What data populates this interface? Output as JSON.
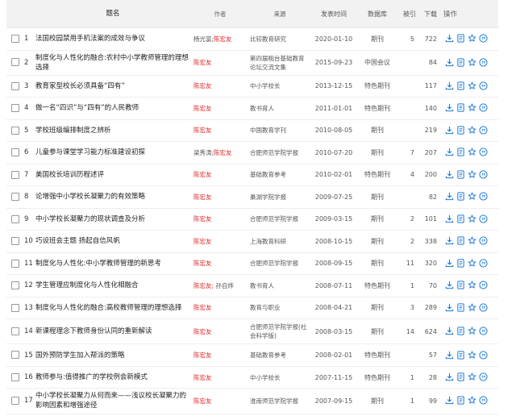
{
  "columns": {
    "title": "题名",
    "author": "作者",
    "source": "来源",
    "date": "发表时间",
    "db": "数据库",
    "cited": "被引",
    "downloads": "下载",
    "ops": "操作"
  },
  "rows": [
    {
      "num": "1",
      "title": "法国校园禁用手机法案的成效与争议",
      "authors": [
        {
          "name": "杨光富;",
          "style": "gray"
        },
        {
          "name": "陈宏友",
          "style": "red"
        }
      ],
      "source": "比较教育研究",
      "date": "2020-01-10",
      "db": "期刊",
      "cited": "5",
      "downloads": "722"
    },
    {
      "num": "2",
      "title": "制度化与人性化的融合:农村中小学教师管理的理想选择",
      "authors": [
        {
          "name": "陈宏友",
          "style": "red"
        }
      ],
      "source": "第四届桃台基础教育论坛交流文集",
      "date": "2015-09-23",
      "db": "中国会议",
      "cited": "",
      "downloads": "84"
    },
    {
      "num": "3",
      "title": "教育家型校长必须具备“四有”",
      "authors": [
        {
          "name": "陈宏友",
          "style": "red"
        }
      ],
      "source": "中小学校长",
      "date": "2013-12-15",
      "db": "特色期刊",
      "cited": "",
      "downloads": "117"
    },
    {
      "num": "4",
      "title": "做一名“四识”与“四有”的人民教师",
      "authors": [
        {
          "name": "陈宏友",
          "style": "red"
        }
      ],
      "source": "教书育人",
      "date": "2011-01-01",
      "db": "特色期刊",
      "cited": "",
      "downloads": "140"
    },
    {
      "num": "5",
      "title": "学校班级编排制度之辨析",
      "authors": [
        {
          "name": "陈宏友",
          "style": "red"
        }
      ],
      "source": "中国教育学刊",
      "date": "2010-08-05",
      "db": "期刊",
      "cited": "",
      "downloads": "219"
    },
    {
      "num": "6",
      "title": "儿童参与课堂学习能力标准建设初探",
      "authors": [
        {
          "name": "梁秀涛;",
          "style": "gray"
        },
        {
          "name": "陈宏友",
          "style": "red"
        }
      ],
      "source": "合肥师范学院学报",
      "date": "2010-07-20",
      "db": "期刊",
      "cited": "7",
      "downloads": "207"
    },
    {
      "num": "7",
      "title": "美国校长培训历程述评",
      "authors": [
        {
          "name": "陈宏友",
          "style": "red"
        }
      ],
      "source": "基础教育参考",
      "date": "2010-02-01",
      "db": "特色期刊",
      "cited": "4",
      "downloads": "200"
    },
    {
      "num": "8",
      "title": "论增强中小学校长凝聚力的有效策略",
      "authors": [
        {
          "name": "陈宏友",
          "style": "red"
        }
      ],
      "source": "巢湖学院学报",
      "date": "2009-07-25",
      "db": "期刊",
      "cited": "",
      "downloads": "82"
    },
    {
      "num": "9",
      "title": "中小学校长凝聚力的现状调查及分析",
      "authors": [
        {
          "name": "陈宏友",
          "style": "red"
        }
      ],
      "source": "合肥师范学院学报",
      "date": "2009-03-15",
      "db": "期刊",
      "cited": "2",
      "downloads": "101"
    },
    {
      "num": "10",
      "title": "巧设班会主题 扬起自信风帆",
      "authors": [
        {
          "name": "陈宏友",
          "style": "red"
        }
      ],
      "source": "上海教育科研",
      "date": "2008-10-15",
      "db": "期刊",
      "cited": "2",
      "downloads": "338"
    },
    {
      "num": "11",
      "title": "制度化与人性化:中小学教师管理的新思考",
      "authors": [
        {
          "name": "陈宏友",
          "style": "red"
        }
      ],
      "source": "合肥师范学院学报",
      "date": "2008-09-15",
      "db": "期刊",
      "cited": "11",
      "downloads": "320"
    },
    {
      "num": "12",
      "title": "学生管理应制度化与人性化相融合",
      "authors": [
        {
          "name": "陈宏友;",
          "style": "red"
        },
        {
          "name": " 孙自烨",
          "style": "gray"
        }
      ],
      "source": "教书育人",
      "date": "2008-07-11",
      "db": "特色期刊",
      "cited": "1",
      "downloads": "70"
    },
    {
      "num": "13",
      "title": "制度化与人性化的融合:高校教师管理的理想选择",
      "authors": [
        {
          "name": "陈宏友",
          "style": "red"
        }
      ],
      "source": "教育与职业",
      "date": "2008-04-21",
      "db": "期刊",
      "cited": "3",
      "downloads": "289"
    },
    {
      "num": "14",
      "title": "新课程理念下教师身份认同的重新解读",
      "authors": [
        {
          "name": "陈宏友",
          "style": "red"
        }
      ],
      "source": "合肥师范学院学报(社会科学版)",
      "date": "2008-03-15",
      "db": "期刊",
      "cited": "14",
      "downloads": "624"
    },
    {
      "num": "15",
      "title": "国外预防学生加入帮派的策略",
      "authors": [
        {
          "name": "陈宏友",
          "style": "red"
        }
      ],
      "source": "基础教育参考",
      "date": "2008-02-01",
      "db": "特色期刊",
      "cited": "",
      "downloads": "57"
    },
    {
      "num": "16",
      "title": "教师参与:值得推广的学校例会新模式",
      "authors": [
        {
          "name": "陈宏友",
          "style": "red"
        }
      ],
      "source": "中小学校长",
      "date": "2007-11-15",
      "db": "特色期刊",
      "cited": "1",
      "downloads": "28"
    },
    {
      "num": "17",
      "title": "中小学校长凝聚力从何而来——浅议校长凝聚力的影响因素和增强途径",
      "authors": [
        {
          "name": "陈宏友",
          "style": "red"
        }
      ],
      "source": "淮南师范学院学报",
      "date": "2007-09-15",
      "db": "期刊",
      "cited": "1",
      "downloads": "99"
    }
  ],
  "row_actions": [
    "download-icon",
    "html-read-icon",
    "favorite-star-icon",
    "quote-icon"
  ],
  "colors": {
    "accent": "#1e7ad6",
    "author_highlight": "#e02424",
    "header_bg": "#f2f2f2"
  }
}
